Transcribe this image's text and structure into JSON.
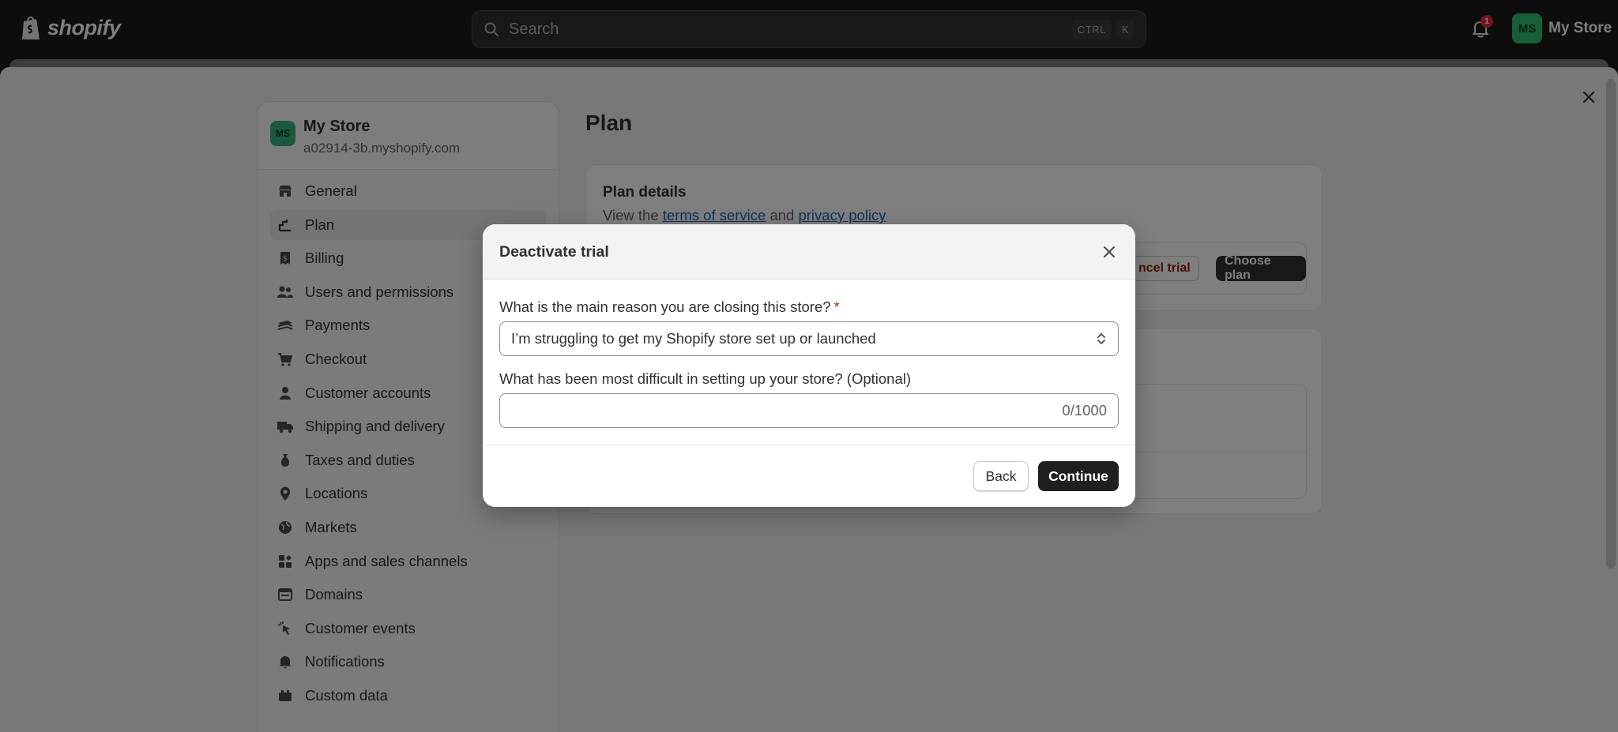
{
  "topbar": {
    "logo_text": "shopify",
    "search_placeholder": "Search",
    "shortcut_keys": [
      "CTRL",
      "K"
    ],
    "notification_count": "1",
    "user_initials": "MS",
    "user_name": "My Store"
  },
  "sidebar": {
    "store_initials": "MS",
    "store_name": "My Store",
    "store_url": "a02914-3b.myshopify.com",
    "items": [
      {
        "label": "General",
        "icon": "store-icon"
      },
      {
        "label": "Plan",
        "icon": "plan-icon",
        "active": true
      },
      {
        "label": "Billing",
        "icon": "billing-icon"
      },
      {
        "label": "Users and permissions",
        "icon": "users-icon"
      },
      {
        "label": "Payments",
        "icon": "payments-icon"
      },
      {
        "label": "Checkout",
        "icon": "cart-icon"
      },
      {
        "label": "Customer accounts",
        "icon": "person-icon"
      },
      {
        "label": "Shipping and delivery",
        "icon": "truck-icon"
      },
      {
        "label": "Taxes and duties",
        "icon": "taxes-icon"
      },
      {
        "label": "Locations",
        "icon": "location-icon"
      },
      {
        "label": "Markets",
        "icon": "globe-icon"
      },
      {
        "label": "Apps and sales channels",
        "icon": "apps-icon"
      },
      {
        "label": "Domains",
        "icon": "domains-icon"
      },
      {
        "label": "Customer events",
        "icon": "cursor-icon"
      },
      {
        "label": "Notifications",
        "icon": "bell-icon"
      },
      {
        "label": "Custom data",
        "icon": "data-icon"
      }
    ]
  },
  "main": {
    "page_title": "Plan",
    "plan_details_title": "Plan details",
    "plan_details_prefix": "View the",
    "terms_link": "terms of service",
    "and_text": "and",
    "privacy_link": "privacy policy",
    "cancel_trial_label": "ncel trial",
    "choose_plan_label": "Choose plan"
  },
  "modal": {
    "title": "Deactivate trial",
    "question1": "What is the main reason you are closing this store?",
    "required_mark": "*",
    "reason_selected": "I’m struggling to get my Shopify store set up or launched",
    "question2": "What has been most difficult in setting up your store? (Optional)",
    "char_counter": "0/1000",
    "back_label": "Back",
    "continue_label": "Continue"
  }
}
